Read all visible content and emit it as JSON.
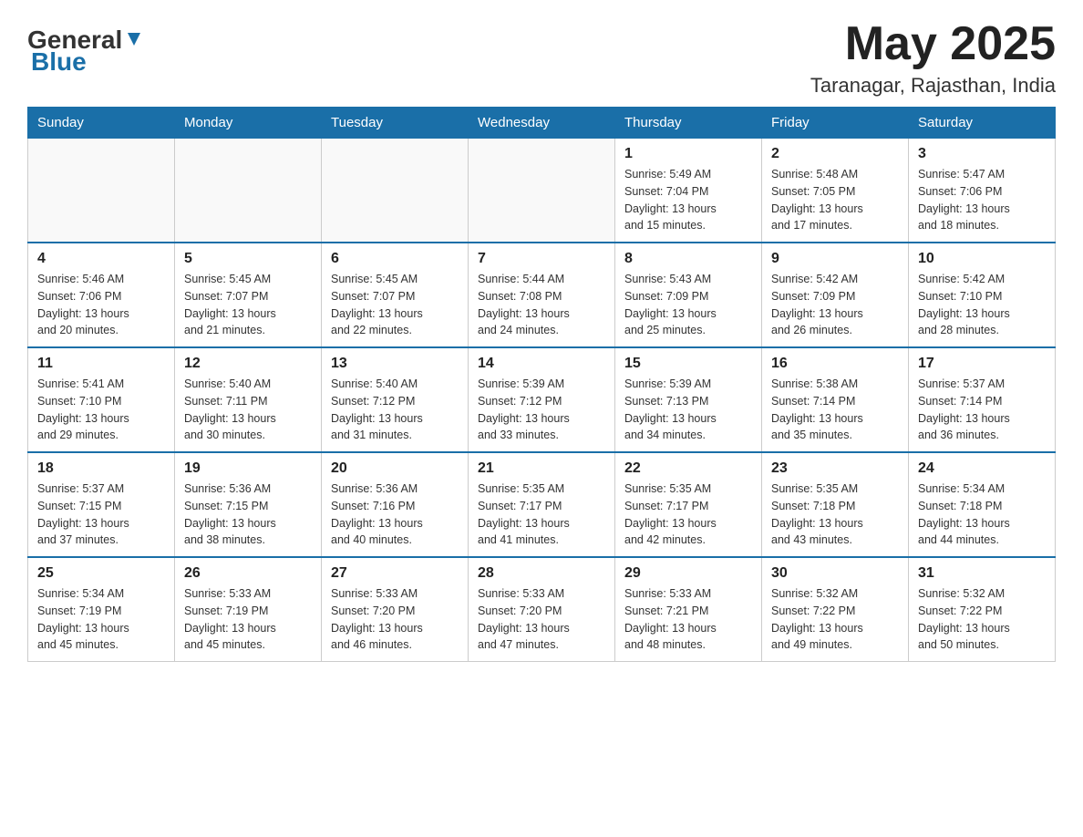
{
  "header": {
    "logo_general": "General",
    "logo_blue": "Blue",
    "month_title": "May 2025",
    "location": "Taranagar, Rajasthan, India"
  },
  "weekdays": [
    "Sunday",
    "Monday",
    "Tuesday",
    "Wednesday",
    "Thursday",
    "Friday",
    "Saturday"
  ],
  "weeks": [
    [
      {
        "day": "",
        "info": ""
      },
      {
        "day": "",
        "info": ""
      },
      {
        "day": "",
        "info": ""
      },
      {
        "day": "",
        "info": ""
      },
      {
        "day": "1",
        "info": "Sunrise: 5:49 AM\nSunset: 7:04 PM\nDaylight: 13 hours\nand 15 minutes."
      },
      {
        "day": "2",
        "info": "Sunrise: 5:48 AM\nSunset: 7:05 PM\nDaylight: 13 hours\nand 17 minutes."
      },
      {
        "day": "3",
        "info": "Sunrise: 5:47 AM\nSunset: 7:06 PM\nDaylight: 13 hours\nand 18 minutes."
      }
    ],
    [
      {
        "day": "4",
        "info": "Sunrise: 5:46 AM\nSunset: 7:06 PM\nDaylight: 13 hours\nand 20 minutes."
      },
      {
        "day": "5",
        "info": "Sunrise: 5:45 AM\nSunset: 7:07 PM\nDaylight: 13 hours\nand 21 minutes."
      },
      {
        "day": "6",
        "info": "Sunrise: 5:45 AM\nSunset: 7:07 PM\nDaylight: 13 hours\nand 22 minutes."
      },
      {
        "day": "7",
        "info": "Sunrise: 5:44 AM\nSunset: 7:08 PM\nDaylight: 13 hours\nand 24 minutes."
      },
      {
        "day": "8",
        "info": "Sunrise: 5:43 AM\nSunset: 7:09 PM\nDaylight: 13 hours\nand 25 minutes."
      },
      {
        "day": "9",
        "info": "Sunrise: 5:42 AM\nSunset: 7:09 PM\nDaylight: 13 hours\nand 26 minutes."
      },
      {
        "day": "10",
        "info": "Sunrise: 5:42 AM\nSunset: 7:10 PM\nDaylight: 13 hours\nand 28 minutes."
      }
    ],
    [
      {
        "day": "11",
        "info": "Sunrise: 5:41 AM\nSunset: 7:10 PM\nDaylight: 13 hours\nand 29 minutes."
      },
      {
        "day": "12",
        "info": "Sunrise: 5:40 AM\nSunset: 7:11 PM\nDaylight: 13 hours\nand 30 minutes."
      },
      {
        "day": "13",
        "info": "Sunrise: 5:40 AM\nSunset: 7:12 PM\nDaylight: 13 hours\nand 31 minutes."
      },
      {
        "day": "14",
        "info": "Sunrise: 5:39 AM\nSunset: 7:12 PM\nDaylight: 13 hours\nand 33 minutes."
      },
      {
        "day": "15",
        "info": "Sunrise: 5:39 AM\nSunset: 7:13 PM\nDaylight: 13 hours\nand 34 minutes."
      },
      {
        "day": "16",
        "info": "Sunrise: 5:38 AM\nSunset: 7:14 PM\nDaylight: 13 hours\nand 35 minutes."
      },
      {
        "day": "17",
        "info": "Sunrise: 5:37 AM\nSunset: 7:14 PM\nDaylight: 13 hours\nand 36 minutes."
      }
    ],
    [
      {
        "day": "18",
        "info": "Sunrise: 5:37 AM\nSunset: 7:15 PM\nDaylight: 13 hours\nand 37 minutes."
      },
      {
        "day": "19",
        "info": "Sunrise: 5:36 AM\nSunset: 7:15 PM\nDaylight: 13 hours\nand 38 minutes."
      },
      {
        "day": "20",
        "info": "Sunrise: 5:36 AM\nSunset: 7:16 PM\nDaylight: 13 hours\nand 40 minutes."
      },
      {
        "day": "21",
        "info": "Sunrise: 5:35 AM\nSunset: 7:17 PM\nDaylight: 13 hours\nand 41 minutes."
      },
      {
        "day": "22",
        "info": "Sunrise: 5:35 AM\nSunset: 7:17 PM\nDaylight: 13 hours\nand 42 minutes."
      },
      {
        "day": "23",
        "info": "Sunrise: 5:35 AM\nSunset: 7:18 PM\nDaylight: 13 hours\nand 43 minutes."
      },
      {
        "day": "24",
        "info": "Sunrise: 5:34 AM\nSunset: 7:18 PM\nDaylight: 13 hours\nand 44 minutes."
      }
    ],
    [
      {
        "day": "25",
        "info": "Sunrise: 5:34 AM\nSunset: 7:19 PM\nDaylight: 13 hours\nand 45 minutes."
      },
      {
        "day": "26",
        "info": "Sunrise: 5:33 AM\nSunset: 7:19 PM\nDaylight: 13 hours\nand 45 minutes."
      },
      {
        "day": "27",
        "info": "Sunrise: 5:33 AM\nSunset: 7:20 PM\nDaylight: 13 hours\nand 46 minutes."
      },
      {
        "day": "28",
        "info": "Sunrise: 5:33 AM\nSunset: 7:20 PM\nDaylight: 13 hours\nand 47 minutes."
      },
      {
        "day": "29",
        "info": "Sunrise: 5:33 AM\nSunset: 7:21 PM\nDaylight: 13 hours\nand 48 minutes."
      },
      {
        "day": "30",
        "info": "Sunrise: 5:32 AM\nSunset: 7:22 PM\nDaylight: 13 hours\nand 49 minutes."
      },
      {
        "day": "31",
        "info": "Sunrise: 5:32 AM\nSunset: 7:22 PM\nDaylight: 13 hours\nand 50 minutes."
      }
    ]
  ]
}
